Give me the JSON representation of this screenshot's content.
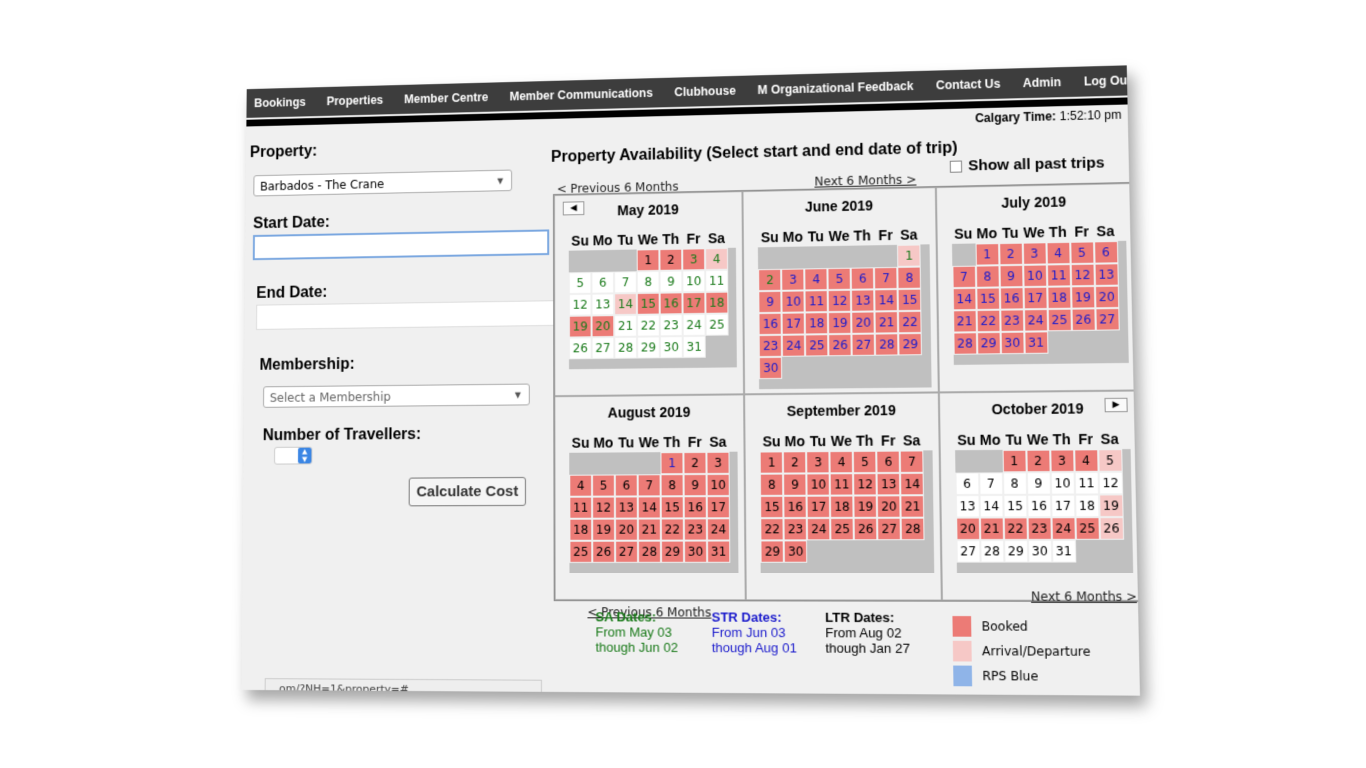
{
  "nav": [
    "Bookings",
    "Properties",
    "Member Centre",
    "Member Communications",
    "Clubhouse",
    "M Organizational Feedback",
    "Contact Us",
    "Admin",
    "Log Out"
  ],
  "time": {
    "label": "Calgary Time:",
    "value": "1:52:10 pm"
  },
  "form": {
    "property_label": "Property:",
    "property_value": "Barbados - The Crane",
    "start_label": "Start Date:",
    "end_label": "End Date:",
    "membership_label": "Membership:",
    "membership_placeholder": "Select a Membership",
    "travellers_label": "Number of Travellers:",
    "calc_button": "Calculate Cost"
  },
  "availability": {
    "title": "Property Availability (Select start and end date of trip)",
    "show_past": "Show all past trips",
    "prev": "< Previous 6 Months",
    "next": "Next 6 Months >"
  },
  "months": [
    {
      "name": "May 2019",
      "start": 3,
      "days": 31,
      "booked": [
        1,
        2,
        3,
        15,
        16,
        17,
        18,
        19,
        20
      ],
      "arr": [
        4,
        14
      ],
      "sa": [
        3,
        4,
        5,
        6,
        7,
        8,
        9,
        10,
        11,
        12,
        13,
        14,
        15,
        16,
        17,
        18,
        19,
        20,
        21,
        22,
        23,
        24,
        25,
        26,
        27,
        28,
        29,
        30,
        31
      ],
      "str": [],
      "nav": "prev"
    },
    {
      "name": "June 2019",
      "start": 6,
      "days": 30,
      "booked": [
        2,
        3,
        4,
        5,
        6,
        7,
        8,
        9,
        10,
        11,
        12,
        13,
        14,
        15,
        16,
        17,
        18,
        19,
        20,
        21,
        22,
        23,
        24,
        25,
        26,
        27,
        28,
        29,
        30
      ],
      "arr": [
        1
      ],
      "sa": [
        1,
        2
      ],
      "str": [
        3,
        4,
        5,
        6,
        7,
        8,
        9,
        10,
        11,
        12,
        13,
        14,
        15,
        16,
        17,
        18,
        19,
        20,
        21,
        22,
        23,
        24,
        25,
        26,
        27,
        28,
        29,
        30
      ],
      "nav": ""
    },
    {
      "name": "July 2019",
      "start": 1,
      "days": 31,
      "booked": [
        1,
        2,
        3,
        4,
        5,
        6,
        7,
        8,
        9,
        10,
        11,
        12,
        13,
        14,
        15,
        16,
        17,
        18,
        19,
        20,
        21,
        22,
        23,
        24,
        25,
        26,
        27,
        28,
        29,
        30,
        31
      ],
      "arr": [],
      "sa": [],
      "str": [
        1,
        2,
        3,
        4,
        5,
        6,
        7,
        8,
        9,
        10,
        11,
        12,
        13,
        14,
        15,
        16,
        17,
        18,
        19,
        20,
        21,
        22,
        23,
        24,
        25,
        26,
        27,
        28,
        29,
        30,
        31
      ],
      "nav": ""
    },
    {
      "name": "August 2019",
      "start": 4,
      "days": 31,
      "booked": [
        1,
        2,
        3,
        4,
        5,
        6,
        7,
        8,
        9,
        10,
        11,
        12,
        13,
        14,
        15,
        16,
        17,
        18,
        19,
        20,
        21,
        22,
        23,
        24,
        25,
        26,
        27,
        28,
        29,
        30,
        31
      ],
      "arr": [],
      "sa": [],
      "str": [
        1
      ],
      "nav": ""
    },
    {
      "name": "September 2019",
      "start": 0,
      "days": 30,
      "booked": [
        1,
        2,
        3,
        4,
        5,
        6,
        7,
        8,
        9,
        10,
        11,
        12,
        13,
        14,
        15,
        16,
        17,
        18,
        19,
        20,
        21,
        22,
        23,
        24,
        25,
        26,
        27,
        28,
        29,
        30
      ],
      "arr": [],
      "sa": [],
      "str": [],
      "nav": ""
    },
    {
      "name": "October 2019",
      "start": 2,
      "days": 31,
      "booked": [
        1,
        2,
        3,
        4,
        20,
        21,
        22,
        23,
        24,
        25
      ],
      "arr": [
        5,
        19,
        26
      ],
      "sa": [],
      "str": [],
      "nav": "next"
    }
  ],
  "legend": {
    "sa_title": "SA Dates:",
    "sa_text": "From May 03 though Jun 02",
    "str_title": "STR Dates:",
    "str_text": "From Jun 03 though Aug 01",
    "ltr_title": "LTR Dates:",
    "ltr_text": "From Aug 02 though Jan 27",
    "key": [
      {
        "label": "Booked",
        "color": "#ec7b76"
      },
      {
        "label": "Arrival/Departure",
        "color": "#f6c8c6"
      },
      {
        "label": "RPS Blue",
        "color": "#8fb4e8"
      }
    ]
  },
  "url": "om/?NH=1&property=#"
}
